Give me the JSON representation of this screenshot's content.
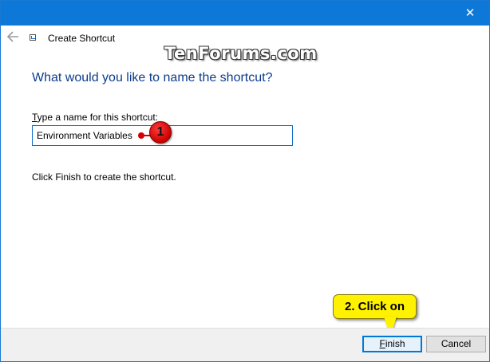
{
  "window": {
    "title": "Create Shortcut",
    "close_glyph": "✕",
    "accent_color": "#0e78d8"
  },
  "watermark": "TenForums.com",
  "heading": "What would you like to name the shortcut?",
  "name_field": {
    "label_access_key": "T",
    "label_rest": "ype a name for this shortcut:",
    "value": "Environment Variables"
  },
  "instruction": "Click Finish to create the shortcut.",
  "annotations": {
    "step1_badge": "1",
    "step2_text": "2. Click on"
  },
  "buttons": {
    "finish_access_key": "F",
    "finish_rest": "inish",
    "cancel": "Cancel"
  },
  "icons": {
    "back": "back-arrow-icon",
    "app": "shortcut-icon",
    "close": "close-icon"
  }
}
